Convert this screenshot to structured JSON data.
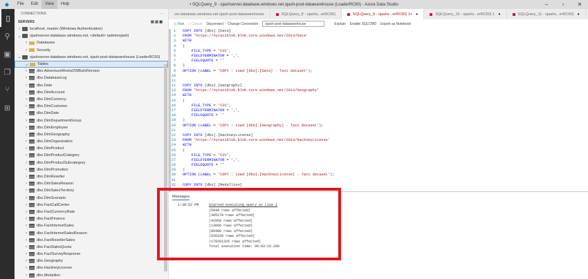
{
  "title": "• SQLQuery_9 - ojashserver.database.windows.net.ojash-pool-datawarehouse (LoaderRC60) - Azure Data Studio",
  "menu": [
    "File",
    "Edit",
    "View",
    "Help"
  ],
  "sidebar": {
    "header": "CONNECTIONS",
    "servers_label": "SERVERS",
    "nodes": [
      {
        "label": "localhost, master (Windows Authentication)",
        "level": 0,
        "type": "srv",
        "chev": ">"
      },
      {
        "label": "ojashserver.database.windows.net, <default> (adminojash)",
        "level": 0,
        "type": "srv",
        "chev": "v"
      },
      {
        "label": "Databases",
        "level": 1,
        "type": "folder",
        "chev": ">"
      },
      {
        "label": "Security",
        "level": 1,
        "type": "folder",
        "chev": ">"
      },
      {
        "label": "ojashserver.database.windows.net, ojash-pool-datawarehouse (LoaderRC60)",
        "level": 0,
        "type": "srv",
        "chev": "v"
      },
      {
        "label": "Tables",
        "level": 1,
        "type": "folder",
        "chev": "v",
        "selected": true
      }
    ],
    "tables": [
      "dbo.AdventureWorksDWBuildVersion",
      "dbo.DatabaseLog",
      "dbo.Date",
      "dbo.DimAccount",
      "dbo.DimCurrency",
      "dbo.DimCustomer",
      "dbo.DimDate",
      "dbo.DimDepartmentGroup",
      "dbo.DimEmployee",
      "dbo.DimGeography",
      "dbo.DimOrganization",
      "dbo.DimProduct",
      "dbo.DimProductCategory",
      "dbo.DimProductSubcategory",
      "dbo.DimPromotion",
      "dbo.DimReseller",
      "dbo.DimSalesReason",
      "dbo.DimSalesTerritory",
      "dbo.DimScenario",
      "dbo.FactCallCenter",
      "dbo.FactCurrencyRate",
      "dbo.FactFinance",
      "dbo.FactInternetSales",
      "dbo.FactInternetSalesReason",
      "dbo.FactResellerSales",
      "dbo.FactSalesQuota",
      "dbo.FactSurveyResponse",
      "dbo.Geography",
      "dbo.HackneyLicense",
      "dbo.Medallion"
    ]
  },
  "tabs": [
    {
      "label": "ver.database.windows.net.ojash-pool-datawarehouse",
      "active": false,
      "icon": false,
      "dirty": false
    },
    {
      "label": "SQLQuery_8 - ojashs...erRC60)",
      "active": false,
      "icon": true,
      "dirty": false
    },
    {
      "label": "SQLQuery_9 - ojashs...erRC60) 1+",
      "active": true,
      "icon": true,
      "dirty": true
    },
    {
      "label": "SQLQuery_10 - ojashs...erRC60) 1",
      "active": false,
      "icon": true,
      "dirty": true
    },
    {
      "label": "SQLQuery_11 - ojashs...erRC60)",
      "active": false,
      "icon": true,
      "dirty": true
    }
  ],
  "toolbar": {
    "run": "▷ Run",
    "cancel": "□ Cancel",
    "disconnect": "Disconnect",
    "change": "Change Connection",
    "database": "ojash-pool-datawarehouse",
    "explain": "Explain",
    "sqlcmd": "Enable SQLCMD",
    "export": "Export as Notebook"
  },
  "code": [
    "COPY INTO [dbo].[Date]",
    "FROM 'https://nytaxiblob.blob.core.windows.net/2013/Date'",
    "WITH",
    "(",
    "    FILE_TYPE = 'CSV',",
    "    FIELDTERMINATOR = ',',",
    "    FIELDQUOTE = ''",
    ")",
    "OPTION (LABEL = 'COPY : Load [dbo].[Date] - Taxi dataset');",
    "",
    "",
    "COPY INTO [dbo].[Geography]",
    "FROM 'https://nytaxiblob.blob.core.windows.net/2013/Geography'",
    "WITH",
    "(",
    "    FILE_TYPE = 'CSV',",
    "    FIELDTERMINATOR = ',',",
    "    FIELDQUOTE = ''",
    ")",
    "OPTION (LABEL = 'COPY : Load [dbo].[Geography] - Taxi dataset');",
    "",
    "COPY INTO [dbo].[HackneyLicense]",
    "FROM 'https://nytaxiblob.blob.core.windows.net/2013/HackneyLicense'",
    "WITH",
    "(",
    "    FILE_TYPE = 'CSV',",
    "    FIELDTERMINATOR = ',',",
    "    FIELDQUOTE = ''",
    ")",
    "OPTION (LABEL = 'COPY : Load [dbo].[HackneyLicense] - Taxi dataset');",
    "",
    "COPY INTO [dbo].[Medallion]"
  ],
  "messages": {
    "header": "Messages",
    "time": "1:38:52 PM",
    "lines": [
      "Started executing query at Line 1",
      "(5844 rows affected)",
      "(305179 rows affected)",
      "(42958 rows affected)",
      "(13668 rows affected)",
      "(86400 rows affected)",
      "(526330 rows affected)",
      "(170261325 rows affected)",
      "Total execution time: 00:03:19.268"
    ]
  },
  "colors": {
    "highlight": "#e3141d",
    "accent": "#0078d4"
  }
}
